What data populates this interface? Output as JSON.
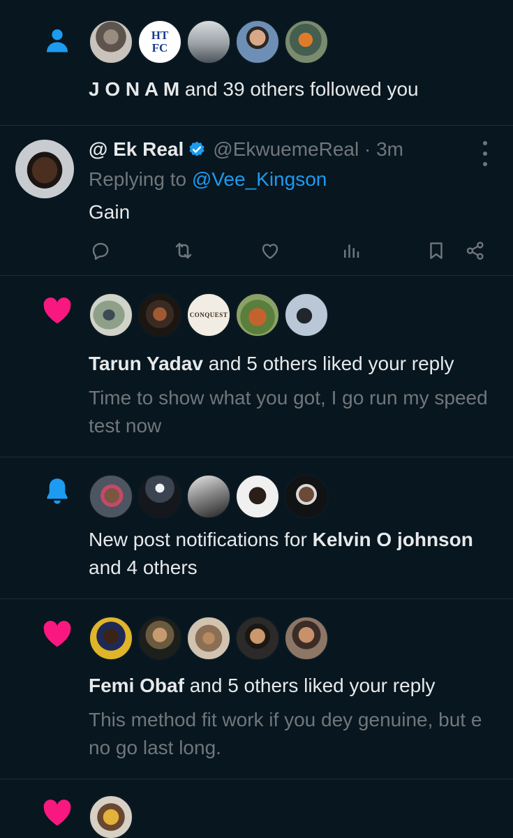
{
  "notifications": [
    {
      "type": "follow",
      "icon": "person-icon",
      "avatars": [
        "avatar-1",
        "avatar-2",
        "avatar-3",
        "avatar-4",
        "avatar-5"
      ],
      "avatar_2_text": "HT FC",
      "text_bold": "J O N A M",
      "text_rest": " and 39 others followed you"
    },
    {
      "type": "reply",
      "author_name": "@ Ek Real",
      "author_handle": "@EkwuemeReal · 3m",
      "replying_label": "Replying to ",
      "replying_to": "@Vee_Kingson",
      "body": "Gain"
    },
    {
      "type": "like",
      "icon": "heart-icon",
      "avatar_3_text": "CONQUEST",
      "text_bold": "Tarun Yadav",
      "text_rest": " and 5 others liked your reply",
      "quote": "Time to show what you got, I go run my speed test now"
    },
    {
      "type": "post-notifications",
      "icon": "bell-icon",
      "text_prefix": "New post notifications for ",
      "text_bold": "Kelvin O johnson",
      "text_rest": " and 4 others"
    },
    {
      "type": "like",
      "icon": "heart-icon",
      "text_bold": "Femi Obaf",
      "text_rest": " and 5 others liked your reply",
      "quote": "This method fit work if you dey genuine, but e no go last long."
    },
    {
      "type": "like",
      "icon": "heart-icon"
    }
  ],
  "colors": {
    "background": "#07161f",
    "accent_blue": "#1d9bf0",
    "like_pink": "#f91880",
    "muted_text": "#71767b",
    "divider": "#1f2d37"
  }
}
